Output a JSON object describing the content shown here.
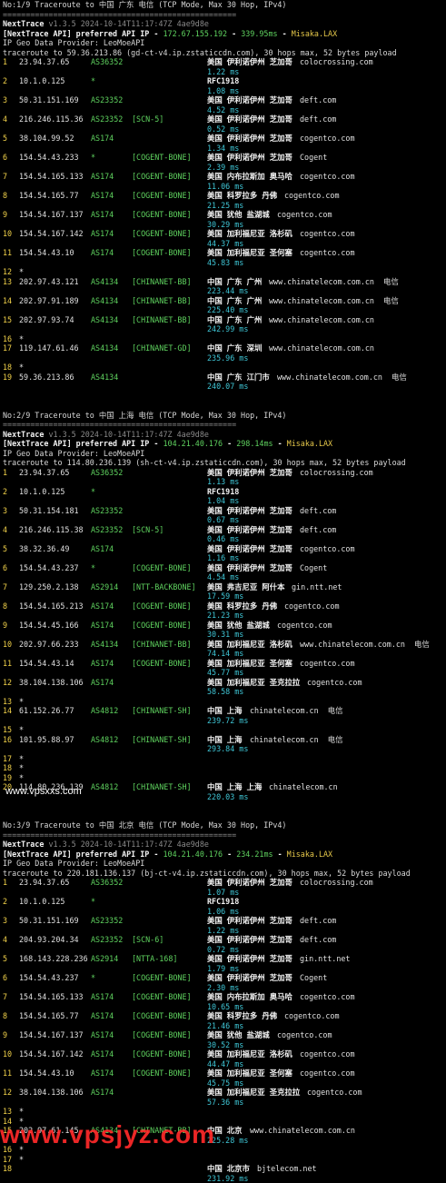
{
  "sections": [
    {
      "header": "No:1/9 Traceroute to 中国 广东 电信 (TCP Mode, Max 30 Hop, IPv4)",
      "separator": "===================================================",
      "nt_name": "NextTrace",
      "nt_version": "v1.3.5 2024-10-14T11:17:47Z 4ae9d8e",
      "api_prefix": "[NextTrace API] preferred API IP - ",
      "api_ip": "172.67.155.192",
      "api_sep": " - ",
      "api_ms": "339.95ms",
      "api_dash": " - ",
      "api_host": "Misaka.LAX",
      "geo": "IP Geo Data Provider: LeoMoeAPI",
      "trace": "traceroute to 59.36.213.86 (gd-ct-v4.ip.zstaticcdn.com), 30 hops max, 52 bytes payload",
      "hops": [
        {
          "n": "1",
          "ip": "23.94.37.65",
          "as": "AS36352",
          "tag": "",
          "loc": "美国 伊利诺伊州 芝加哥",
          "host": "colocrossing.com",
          "ms": "1.22 ms"
        },
        {
          "n": "2",
          "ip": "10.1.0.125",
          "as": "*",
          "tag": "",
          "loc": "RFC1918",
          "host": "",
          "ms": "1.08 ms"
        },
        {
          "n": "3",
          "ip": "50.31.151.169",
          "as": "AS23352",
          "tag": "",
          "loc": "美国 伊利诺伊州 芝加哥",
          "host": "deft.com",
          "ms": "4.52 ms"
        },
        {
          "n": "4",
          "ip": "216.246.115.36",
          "as": "AS23352",
          "tag": "[SCN-5]",
          "loc": "美国 伊利诺伊州 芝加哥",
          "host": "deft.com",
          "ms": "0.52 ms"
        },
        {
          "n": "5",
          "ip": "38.104.99.52",
          "as": "AS174",
          "tag": "",
          "loc": "美国 伊利诺伊州 芝加哥",
          "host": "cogentco.com",
          "ms": "1.34 ms"
        },
        {
          "n": "6",
          "ip": "154.54.43.233",
          "as": "*",
          "tag": "[COGENT-BONE]",
          "loc": "美国 伊利诺伊州 芝加哥",
          "host": "Cogent",
          "ms": "2.39 ms"
        },
        {
          "n": "7",
          "ip": "154.54.165.133",
          "as": "AS174",
          "tag": "[COGENT-BONE]",
          "loc": "美国 内布拉斯加 奥马哈",
          "host": "cogentco.com",
          "ms": "11.06 ms"
        },
        {
          "n": "8",
          "ip": "154.54.165.77",
          "as": "AS174",
          "tag": "[COGENT-BONE]",
          "loc": "美国 科罗拉多 丹佛",
          "host": "cogentco.com",
          "ms": "21.25 ms"
        },
        {
          "n": "9",
          "ip": "154.54.167.137",
          "as": "AS174",
          "tag": "[COGENT-BONE]",
          "loc": "美国 犹他 盐湖城",
          "host": "cogentco.com",
          "ms": "30.29 ms"
        },
        {
          "n": "10",
          "ip": "154.54.167.142",
          "as": "AS174",
          "tag": "[COGENT-BONE]",
          "loc": "美国 加利福尼亚 洛杉矶",
          "host": "cogentco.com",
          "ms": "44.37 ms"
        },
        {
          "n": "11",
          "ip": "154.54.43.10",
          "as": "AS174",
          "tag": "[COGENT-BONE]",
          "loc": "美国 加利福尼亚 圣何塞",
          "host": "cogentco.com",
          "ms": "45.83 ms"
        },
        {
          "n": "12",
          "ip": "*",
          "as": "",
          "tag": "",
          "loc": "",
          "host": "",
          "ms": ""
        },
        {
          "n": "13",
          "ip": "202.97.43.121",
          "as": "AS4134",
          "tag": "[CHINANET-BB]",
          "loc": "中国 广东 广州",
          "host": "www.chinatelecom.com.cn  电信",
          "ms": "223.44 ms"
        },
        {
          "n": "14",
          "ip": "202.97.91.189",
          "as": "AS4134",
          "tag": "[CHINANET-BB]",
          "loc": "中国 广东 广州",
          "host": "www.chinatelecom.com.cn  电信",
          "ms": "225.40 ms"
        },
        {
          "n": "15",
          "ip": "202.97.93.74",
          "as": "AS4134",
          "tag": "[CHINANET-BB]",
          "loc": "中国 广东 广州",
          "host": "www.chinatelecom.com.cn",
          "ms": "242.99 ms"
        },
        {
          "n": "16",
          "ip": "*",
          "as": "",
          "tag": "",
          "loc": "",
          "host": "",
          "ms": ""
        },
        {
          "n": "17",
          "ip": "119.147.61.46",
          "as": "AS4134",
          "tag": "[CHINANET-GD]",
          "loc": "中国 广东 深圳",
          "host": "www.chinatelecom.com.cn",
          "ms": "235.96 ms"
        },
        {
          "n": "18",
          "ip": "*",
          "as": "",
          "tag": "",
          "loc": "",
          "host": "",
          "ms": ""
        },
        {
          "n": "19",
          "ip": "59.36.213.86",
          "as": "AS4134",
          "tag": "",
          "loc": "中国 广东 江门市",
          "host": "www.chinatelecom.com.cn  电信",
          "ms": "240.07 ms"
        }
      ]
    },
    {
      "header": "No:2/9 Traceroute to 中国 上海 电信 (TCP Mode, Max 30 Hop, IPv4)",
      "separator": "===================================================",
      "nt_name": "NextTrace",
      "nt_version": "v1.3.5 2024-10-14T11:17:47Z 4ae9d8e",
      "api_prefix": "[NextTrace API] preferred API IP - ",
      "api_ip": "104.21.40.176",
      "api_sep": " - ",
      "api_ms": "298.14ms",
      "api_dash": " - ",
      "api_host": "Misaka.LAX",
      "geo": "IP Geo Data Provider: LeoMoeAPI",
      "trace": "traceroute to 114.80.236.139 (sh-ct-v4.ip.zstaticcdn.com), 30 hops max, 52 bytes payload",
      "hops": [
        {
          "n": "1",
          "ip": "23.94.37.65",
          "as": "AS36352",
          "tag": "",
          "loc": "美国 伊利诺伊州 芝加哥",
          "host": "colocrossing.com",
          "ms": "1.13 ms"
        },
        {
          "n": "2",
          "ip": "10.1.0.125",
          "as": "*",
          "tag": "",
          "loc": "RFC1918",
          "host": "",
          "ms": "1.04 ms"
        },
        {
          "n": "3",
          "ip": "50.31.154.181",
          "as": "AS23352",
          "tag": "",
          "loc": "美国 伊利诺伊州 芝加哥",
          "host": "deft.com",
          "ms": "0.67 ms"
        },
        {
          "n": "4",
          "ip": "216.246.115.38",
          "as": "AS23352",
          "tag": "[SCN-5]",
          "loc": "美国 伊利诺伊州 芝加哥",
          "host": "deft.com",
          "ms": "0.46 ms"
        },
        {
          "n": "5",
          "ip": "38.32.36.49",
          "as": "AS174",
          "tag": "",
          "loc": "美国 伊利诺伊州 芝加哥",
          "host": "cogentco.com",
          "ms": "1.16 ms"
        },
        {
          "n": "6",
          "ip": "154.54.43.237",
          "as": "*",
          "tag": "[COGENT-BONE]",
          "loc": "美国 伊利诺伊州 芝加哥",
          "host": "Cogent",
          "ms": "4.54 ms"
        },
        {
          "n": "7",
          "ip": "129.250.2.138",
          "as": "AS2914",
          "tag": "[NTT-BACKBONE]",
          "loc": "美国 弗吉尼亚 阿什本",
          "host": "gin.ntt.net",
          "ms": "17.59 ms"
        },
        {
          "n": "8",
          "ip": "154.54.165.213",
          "as": "AS174",
          "tag": "[COGENT-BONE]",
          "loc": "美国 科罗拉多 丹佛",
          "host": "cogentco.com",
          "ms": "21.23 ms"
        },
        {
          "n": "9",
          "ip": "154.54.45.166",
          "as": "AS174",
          "tag": "[COGENT-BONE]",
          "loc": "美国 犹他 盐湖城",
          "host": "cogentco.com",
          "ms": "30.31 ms"
        },
        {
          "n": "10",
          "ip": "202.97.66.233",
          "as": "AS4134",
          "tag": "[CHINANET-BB]",
          "loc": "美国 加利福尼亚 洛杉矶",
          "host": "www.chinatelecom.com.cn  电信",
          "ms": "74.14 ms"
        },
        {
          "n": "11",
          "ip": "154.54.43.14",
          "as": "AS174",
          "tag": "[COGENT-BONE]",
          "loc": "美国 加利福尼亚 圣何塞",
          "host": "cogentco.com",
          "ms": "45.77 ms"
        },
        {
          "n": "12",
          "ip": "38.104.138.106",
          "as": "AS174",
          "tag": "",
          "loc": "美国 加利福尼亚 圣克拉拉",
          "host": "cogentco.com",
          "ms": "58.58 ms"
        },
        {
          "n": "13",
          "ip": "*",
          "as": "",
          "tag": "",
          "loc": "",
          "host": "",
          "ms": ""
        },
        {
          "n": "14",
          "ip": "61.152.26.77",
          "as": "AS4812",
          "tag": "[CHINANET-SH]",
          "loc": "中国 上海",
          "host": "chinatelecom.cn  电信",
          "ms": "239.72 ms"
        },
        {
          "n": "15",
          "ip": "*",
          "as": "",
          "tag": "",
          "loc": "",
          "host": "",
          "ms": ""
        },
        {
          "n": "16",
          "ip": "101.95.88.97",
          "as": "AS4812",
          "tag": "[CHINANET-SH]",
          "loc": "中国 上海",
          "host": "chinatelecom.cn  电信",
          "ms": "293.84 ms"
        },
        {
          "n": "17",
          "ip": "*",
          "as": "",
          "tag": "",
          "loc": "",
          "host": "",
          "ms": ""
        },
        {
          "n": "18",
          "ip": "*",
          "as": "",
          "tag": "",
          "loc": "",
          "host": "",
          "ms": ""
        },
        {
          "n": "19",
          "ip": "*",
          "as": "",
          "tag": "",
          "loc": "",
          "host": "",
          "ms": ""
        },
        {
          "n": "20",
          "ip": "114.80.236.139",
          "as": "AS4812",
          "tag": "[CHINANET-SH]",
          "loc": "中国 上海 上海",
          "host": "chinatelecom.cn",
          "ms": "220.03 ms"
        }
      ]
    },
    {
      "header": "No:3/9 Traceroute to 中国 北京 电信 (TCP Mode, Max 30 Hop, IPv4)",
      "separator": "===================================================",
      "nt_name": "NextTrace",
      "nt_version": "v1.3.5 2024-10-14T11:17:47Z 4ae9d8e",
      "api_prefix": "[NextTrace API] preferred API IP - ",
      "api_ip": "104.21.40.176",
      "api_sep": " - ",
      "api_ms": "234.21ms",
      "api_dash": " - ",
      "api_host": "Misaka.LAX",
      "geo": "IP Geo Data Provider: LeoMoeAPI",
      "trace": "traceroute to 220.181.136.137 (bj-ct-v4.ip.zstaticcdn.com), 30 hops max, 52 bytes payload",
      "hops": [
        {
          "n": "1",
          "ip": "23.94.37.65",
          "as": "AS36352",
          "tag": "",
          "loc": "美国 伊利诺伊州 芝加哥",
          "host": "colocrossing.com",
          "ms": "1.07 ms"
        },
        {
          "n": "2",
          "ip": "10.1.0.125",
          "as": "*",
          "tag": "",
          "loc": "RFC1918",
          "host": "",
          "ms": "1.06 ms"
        },
        {
          "n": "3",
          "ip": "50.31.151.169",
          "as": "AS23352",
          "tag": "",
          "loc": "美国 伊利诺伊州 芝加哥",
          "host": "deft.com",
          "ms": "1.22 ms"
        },
        {
          "n": "4",
          "ip": "204.93.204.34",
          "as": "AS23352",
          "tag": "[SCN-6]",
          "loc": "美国 伊利诺伊州 芝加哥",
          "host": "deft.com",
          "ms": "0.72 ms"
        },
        {
          "n": "5",
          "ip": "168.143.228.236",
          "as": "AS2914",
          "tag": "[NTTA-168]",
          "loc": "美国 伊利诺伊州 芝加哥",
          "host": "gin.ntt.net",
          "ms": "1.79 ms"
        },
        {
          "n": "6",
          "ip": "154.54.43.237",
          "as": "*",
          "tag": "[COGENT-BONE]",
          "loc": "美国 伊利诺伊州 芝加哥",
          "host": "Cogent",
          "ms": "2.30 ms"
        },
        {
          "n": "7",
          "ip": "154.54.165.133",
          "as": "AS174",
          "tag": "[COGENT-BONE]",
          "loc": "美国 内布拉斯加 奥马哈",
          "host": "cogentco.com",
          "ms": "10.65 ms"
        },
        {
          "n": "8",
          "ip": "154.54.165.77",
          "as": "AS174",
          "tag": "[COGENT-BONE]",
          "loc": "美国 科罗拉多 丹佛",
          "host": "cogentco.com",
          "ms": "21.46 ms"
        },
        {
          "n": "9",
          "ip": "154.54.167.137",
          "as": "AS174",
          "tag": "[COGENT-BONE]",
          "loc": "美国 犹他 盐湖城",
          "host": "cogentco.com",
          "ms": "30.52 ms"
        },
        {
          "n": "10",
          "ip": "154.54.167.142",
          "as": "AS174",
          "tag": "[COGENT-BONE]",
          "loc": "美国 加利福尼亚 洛杉矶",
          "host": "cogentco.com",
          "ms": "44.47 ms"
        },
        {
          "n": "11",
          "ip": "154.54.43.10",
          "as": "AS174",
          "tag": "[COGENT-BONE]",
          "loc": "美国 加利福尼亚 圣何塞",
          "host": "cogentco.com",
          "ms": "45.75 ms"
        },
        {
          "n": "12",
          "ip": "38.104.138.106",
          "as": "AS174",
          "tag": "",
          "loc": "美国 加利福尼亚 圣克拉拉",
          "host": "cogentco.com",
          "ms": "57.36 ms"
        },
        {
          "n": "13",
          "ip": "*",
          "as": "",
          "tag": "",
          "loc": "",
          "host": "",
          "ms": ""
        },
        {
          "n": "14",
          "ip": "*",
          "as": "",
          "tag": "",
          "loc": "",
          "host": "",
          "ms": ""
        },
        {
          "n": "15",
          "ip": "202.97.61.145",
          "as": "AS4134",
          "tag": "[CHINANET-BB]",
          "loc": "中国 北京",
          "host": "www.chinatelecom.com.cn",
          "ms": "225.28 ms"
        },
        {
          "n": "16",
          "ip": "*",
          "as": "",
          "tag": "",
          "loc": "",
          "host": "",
          "ms": ""
        },
        {
          "n": "17",
          "ip": "*",
          "as": "",
          "tag": "",
          "loc": "",
          "host": "",
          "ms": ""
        },
        {
          "n": "18",
          "ip": "",
          "as": "",
          "tag": "",
          "loc": "中国 北京市",
          "host": "bjtelecom.net",
          "ms": "231.92 ms"
        }
      ]
    }
  ],
  "watermarks": {
    "small": "www.vpsxxs.com",
    "large": "www.vpsjyz.com"
  }
}
